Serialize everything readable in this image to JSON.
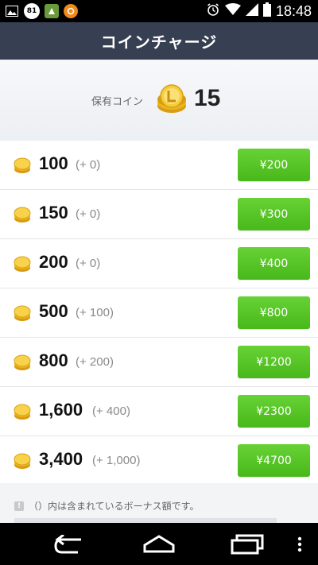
{
  "status_bar": {
    "time": "18:48",
    "notification_badge": "81",
    "icons": [
      "gallery-icon",
      "badge-81-icon",
      "app-icon",
      "app-orange-icon",
      "alarm-icon",
      "wifi-icon",
      "signal-icon",
      "battery-icon"
    ]
  },
  "title": "コインチャージ",
  "balance": {
    "label": "保有コイン",
    "value": "15"
  },
  "packages": [
    {
      "amount": "100",
      "bonus": "(+ 0)",
      "price": "¥200"
    },
    {
      "amount": "150",
      "bonus": "(+ 0)",
      "price": "¥300"
    },
    {
      "amount": "200",
      "bonus": "(+ 0)",
      "price": "¥400"
    },
    {
      "amount": "500",
      "bonus": "(+ 100)",
      "price": "¥800"
    },
    {
      "amount": "800",
      "bonus": "(+ 200)",
      "price": "¥1200"
    },
    {
      "amount": "1,600",
      "bonus": "(+ 400)",
      "price": "¥2300"
    },
    {
      "amount": "3,400",
      "bonus": "(+ 1,000)",
      "price": "¥4700"
    }
  ],
  "note": "（）内は含まれているボーナス額です。",
  "colors": {
    "title_bar": "#373f52",
    "buy_button": "#55c224",
    "coin": "#f2c12e"
  },
  "nav_icons": [
    "back-icon",
    "home-icon",
    "recent-apps-icon",
    "menu-icon"
  ]
}
